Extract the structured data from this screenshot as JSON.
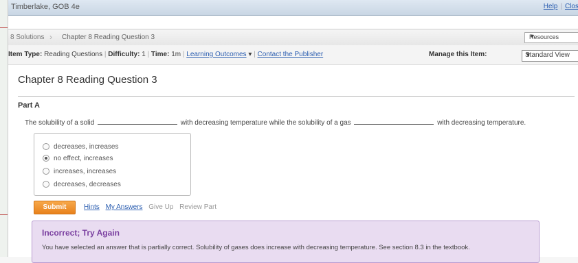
{
  "app": {
    "title": "Timberlake, GOB 4e"
  },
  "top_links": {
    "help": "Help",
    "close": "Clos"
  },
  "breadcrumb": {
    "parent": "8 Solutions",
    "current": "Chapter 8 Reading Question 3"
  },
  "resources_select": {
    "value": "Resources"
  },
  "item_bar": {
    "item_type_label": "Item Type:",
    "item_type_value": "Reading Questions",
    "difficulty_label": "Difficulty:",
    "difficulty_value": "1",
    "time_label": "Time:",
    "time_value": "1m",
    "learning_outcomes": "Learning Outcomes",
    "contact": "Contact the Publisher",
    "manage_label": "Manage this Item:",
    "view_value": "Standard View"
  },
  "question": {
    "title": "Chapter 8 Reading Question 3",
    "part_label": "Part A",
    "text_part1": "The solubility of a solid",
    "text_part2": "with decreasing temperature while the solubility of a gas",
    "text_part3": "with decreasing temperature."
  },
  "choices": [
    {
      "label": "decreases, increases",
      "selected": false
    },
    {
      "label": "no effect, increases",
      "selected": true
    },
    {
      "label": "increases, increases",
      "selected": false
    },
    {
      "label": "decreases, decreases",
      "selected": false
    }
  ],
  "actions": {
    "submit": "Submit",
    "hints": "Hints",
    "my_answers": "My Answers",
    "give_up": "Give Up",
    "review_part": "Review Part"
  },
  "feedback": {
    "title": "Incorrect; Try Again",
    "text": "You have selected an answer that is partially correct. Solubility of gases does increase with decreasing temperature. See section 8.3 in the textbook."
  },
  "colors": {
    "accent_orange": "#e8821c",
    "feedback_bg": "#e9dcf1",
    "feedback_title": "#7a3fa0",
    "link": "#2a5db0"
  }
}
